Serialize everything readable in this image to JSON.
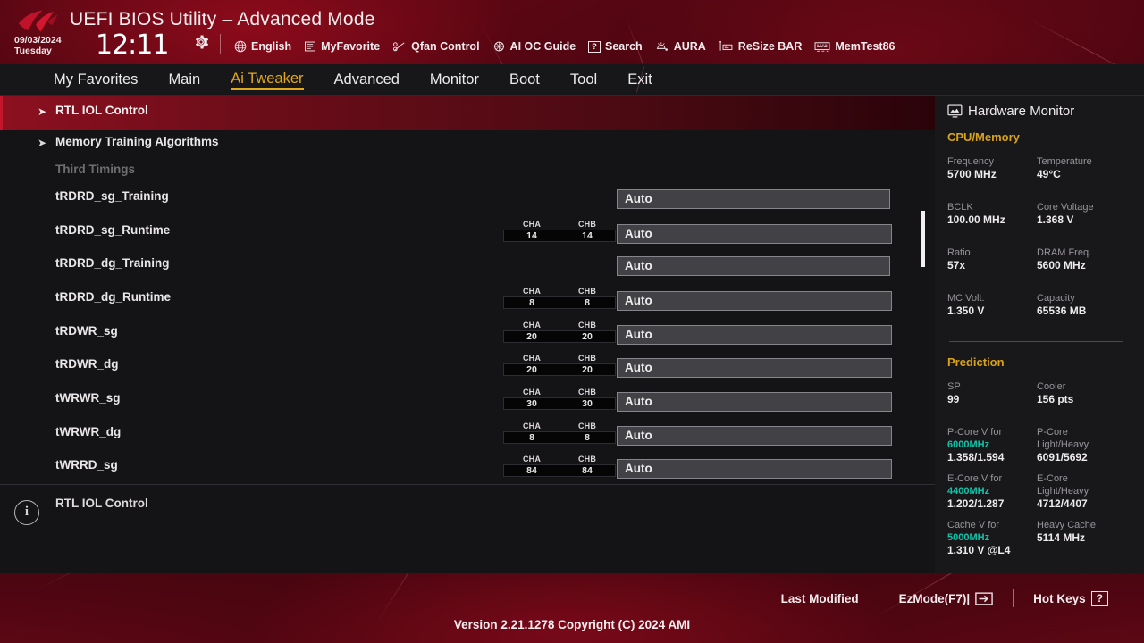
{
  "header": {
    "title": "UEFI BIOS Utility – Advanced Mode",
    "date": "09/03/2024",
    "weekday": "Tuesday",
    "time": "12:11",
    "gear_icon": "gear-icon",
    "tools": [
      {
        "icon": "globe-icon",
        "label": "English"
      },
      {
        "icon": "list-icon",
        "label": "MyFavorite"
      },
      {
        "icon": "fan-icon",
        "label": "Qfan Control"
      },
      {
        "icon": "brain-icon",
        "label": "AI OC Guide"
      },
      {
        "icon": "question-icon",
        "label": "Search"
      },
      {
        "icon": "aura-icon",
        "label": "AURA"
      },
      {
        "icon": "resize-icon",
        "label": "ReSize BAR"
      },
      {
        "icon": "memtest-icon",
        "label": "MemTest86"
      }
    ]
  },
  "menu": {
    "items": [
      {
        "label": "My Favorites",
        "active": false
      },
      {
        "label": "Main",
        "active": false
      },
      {
        "label": "Ai Tweaker",
        "active": true
      },
      {
        "label": "Advanced",
        "active": false
      },
      {
        "label": "Monitor",
        "active": false
      },
      {
        "label": "Boot",
        "active": false
      },
      {
        "label": "Tool",
        "active": false
      },
      {
        "label": "Exit",
        "active": false
      }
    ]
  },
  "settings": {
    "rows": [
      {
        "label": "RTL IOL Control",
        "type": "submenu",
        "selected": true
      },
      {
        "label": "Memory Training Algorithms",
        "type": "submenu",
        "selected": false
      },
      {
        "label": "Third Timings",
        "type": "header",
        "selected": false
      },
      {
        "label": "tRDRD_sg_Training",
        "type": "field",
        "value": "Auto",
        "cha": null,
        "chb": null
      },
      {
        "label": "tRDRD_sg_Runtime",
        "type": "field",
        "value": "Auto",
        "cha": "14",
        "chb": "14"
      },
      {
        "label": "tRDRD_dg_Training",
        "type": "field",
        "value": "Auto",
        "cha": null,
        "chb": null
      },
      {
        "label": "tRDRD_dg_Runtime",
        "type": "field",
        "value": "Auto",
        "cha": "8",
        "chb": "8"
      },
      {
        "label": "tRDWR_sg",
        "type": "field",
        "value": "Auto",
        "cha": "20",
        "chb": "20"
      },
      {
        "label": "tRDWR_dg",
        "type": "field",
        "value": "Auto",
        "cha": "20",
        "chb": "20"
      },
      {
        "label": "tWRWR_sg",
        "type": "field",
        "value": "Auto",
        "cha": "30",
        "chb": "30"
      },
      {
        "label": "tWRWR_dg",
        "type": "field",
        "value": "Auto",
        "cha": "8",
        "chb": "8"
      },
      {
        "label": "tWRRD_sg",
        "type": "field",
        "value": "Auto",
        "cha": "84",
        "chb": "84"
      }
    ],
    "channel_labels": {
      "cha": "CHA",
      "chb": "CHB"
    }
  },
  "help": {
    "icon": "info-icon",
    "text": "RTL IOL Control"
  },
  "hardware_monitor": {
    "title": "Hardware Monitor",
    "title_icon": "monitor-icon",
    "sections": [
      {
        "name": "CPU/Memory",
        "pairs": [
          {
            "k1": "Frequency",
            "v1": "5700 MHz",
            "k2": "Temperature",
            "v2": "49°C"
          },
          {
            "k1": "BCLK",
            "v1": "100.00 MHz",
            "k2": "Core Voltage",
            "v2": "1.368 V"
          },
          {
            "k1": "Ratio",
            "v1": "57x",
            "k2": "DRAM Freq.",
            "v2": "5600 MHz"
          },
          {
            "k1": "MC Volt.",
            "v1": "1.350 V",
            "k2": "Capacity",
            "v2": "65536 MB"
          }
        ]
      },
      {
        "name": "Prediction",
        "pairs": [
          {
            "k1": "SP",
            "v1": "99",
            "k2": "Cooler",
            "v2": "156 pts"
          },
          {
            "k1": "P-Core V for",
            "k1b": "6000MHz",
            "v1": "1.358/1.594",
            "k2": "P-Core",
            "k2b": "Light/Heavy",
            "v2": "6091/5692"
          },
          {
            "k1": "E-Core V for",
            "k1b": "4400MHz",
            "v1": "1.202/1.287",
            "k2": "E-Core",
            "k2b": "Light/Heavy",
            "v2": "4712/4407"
          },
          {
            "k1": "Cache V for",
            "k1b": "5000MHz",
            "v1": "1.310 V @L4",
            "k2": "Heavy Cache",
            "v2": "5114 MHz"
          }
        ]
      }
    ]
  },
  "footer": {
    "items": [
      {
        "label": "Last Modified",
        "icon": null
      },
      {
        "label": "EzMode(F7)|",
        "icon": "arrow-right-icon"
      },
      {
        "label": "Hot Keys",
        "icon": "question-icon"
      }
    ],
    "version": "Version 2.21.1278 Copyright (C) 2024 AMI"
  },
  "colors": {
    "accent_gold": "#e0a81c",
    "selected_red": "#8c1020",
    "cyan": "#13c2a8",
    "panel_bg": "#141416"
  }
}
